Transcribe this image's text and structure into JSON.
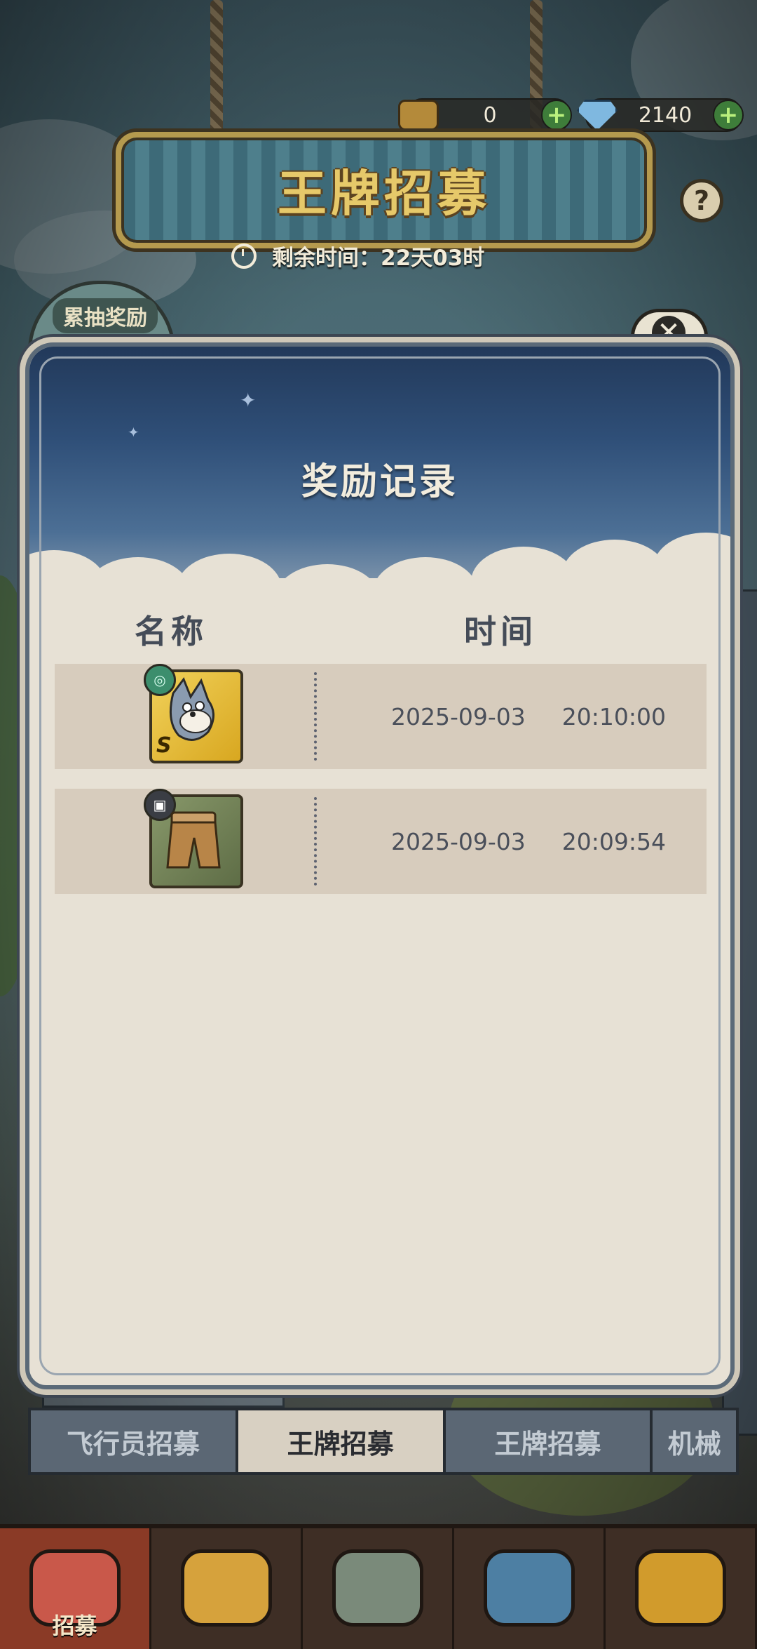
{
  "currencies": [
    {
      "name": "coupon-icon",
      "value": "0"
    },
    {
      "name": "diamond-icon",
      "value": "2140"
    }
  ],
  "header": {
    "title": "王牌招募",
    "timer_label": "剩余时间：",
    "timer_value": "22天03时"
  },
  "side": {
    "badge_label": "累抽奖励"
  },
  "modal": {
    "title": "奖励记录",
    "col_name": "名称",
    "col_time": "时间",
    "records": [
      {
        "item_icon": "tom-character-card-icon",
        "rank": "S",
        "date": "2025-09-03",
        "time": "20:10:00"
      },
      {
        "item_icon": "brown-pants-costume-icon",
        "rank": "",
        "date": "2025-09-03",
        "time": "20:09:54"
      }
    ]
  },
  "tabs": [
    {
      "label": "飞行员招募",
      "active": false
    },
    {
      "label": "王牌招募",
      "active": true
    },
    {
      "label": "王牌招募",
      "active": false
    },
    {
      "label": "机械",
      "active": false
    }
  ],
  "nav": {
    "items": [
      {
        "label": "招募",
        "icon": "recruit-icon",
        "active": true
      },
      {
        "label": "",
        "icon": "shop-bag-icon",
        "active": false
      },
      {
        "label": "",
        "icon": "machine-icon",
        "active": false
      },
      {
        "label": "",
        "icon": "goggles-chest-icon",
        "active": false
      },
      {
        "label": "",
        "icon": "star-chest-icon",
        "active": false
      }
    ]
  },
  "colors": {
    "accent_gold": "#e6c96a",
    "modal_paper": "#e7e1d5",
    "active_tab": "#d8d0c2",
    "nav_active": "#8a3a26"
  }
}
